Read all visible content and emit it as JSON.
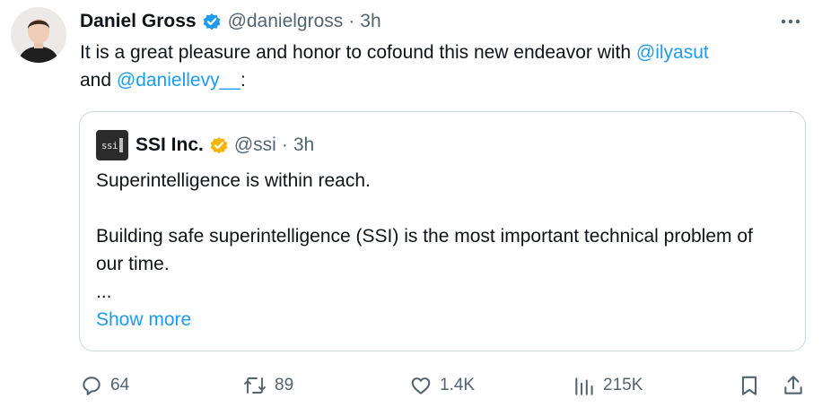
{
  "author": {
    "name": "Daniel Gross",
    "handle": "@danielgross",
    "separator": "·",
    "time": "3h"
  },
  "tweet": {
    "text_before": "It is a great pleasure and honor to cofound this new endeavor with ",
    "mention_1": "@ilyasut",
    "text_mid": "and ",
    "mention_2": "@daniellevy__",
    "text_after": ":"
  },
  "quote": {
    "logo_text": "ssi",
    "name": "SSI Inc.",
    "handle": "@ssi",
    "separator": "·",
    "time": "3h",
    "line_1": "Superintelligence is within reach.",
    "line_2": "Building safe superintelligence (SSI) is the most important technical problem of our time.",
    "ellipsis": "...",
    "show_more": "Show more"
  },
  "actions": {
    "replies": "64",
    "reposts": "89",
    "likes": "1.4K",
    "views": "215K"
  },
  "icons": {
    "verified": "verified-badge-icon",
    "quote_badge": "gold-verified-badge-icon",
    "more": "more-icon",
    "reply": "reply-icon",
    "repost": "repost-icon",
    "like": "heart-icon",
    "views": "views-icon",
    "bookmark": "bookmark-icon",
    "share": "share-icon"
  },
  "colors": {
    "link": "#1d9bf0",
    "secondary_text": "#536471",
    "border": "#cfd9de",
    "gold_badge": "#f4b400"
  }
}
